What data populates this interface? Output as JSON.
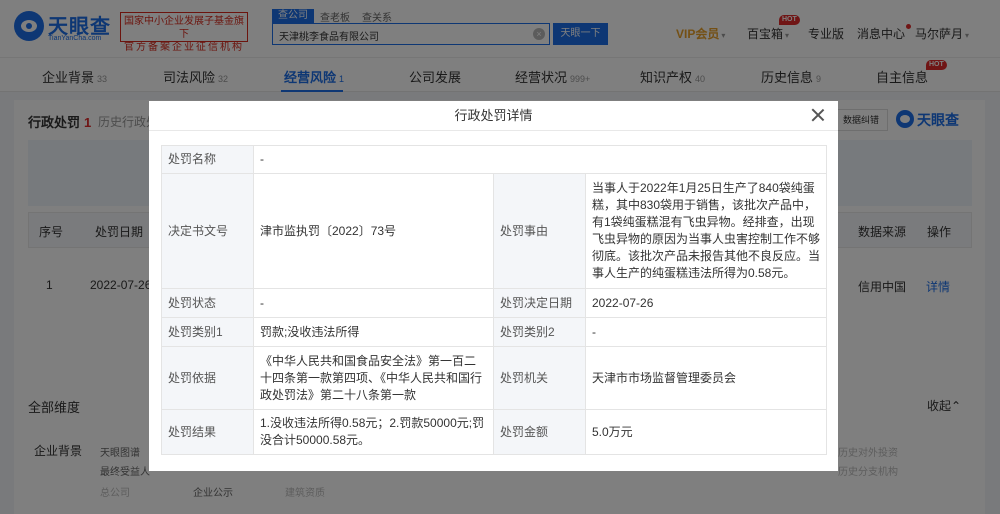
{
  "header": {
    "logo_cn": "天眼查",
    "logo_en": "TianYanCha.com",
    "cert_line1": "国家中小企业发展子基金旗下",
    "cert_line2": "官方备案企业征信机构",
    "search_tabs": [
      "查公司",
      "查老板",
      "查关系"
    ],
    "search_value": "天津桃李食品有限公司",
    "search_clear_glyph": "×",
    "search_button": "天眼一下",
    "vip": "VIP会员",
    "baibaoxiang": "百宝箱",
    "hot_badge": "HOT",
    "professional": "专业版",
    "messages": "消息中心",
    "username": "马尔萨月",
    "caret": "▾",
    "colors": {
      "brand": "#1c6ee8",
      "vip": "#e8a02a",
      "hot": "#e02a2a"
    }
  },
  "category_tabs": [
    {
      "label": "企业背景",
      "count": "33"
    },
    {
      "label": "司法风险",
      "count": "32"
    },
    {
      "label": "经营风险",
      "count": "1",
      "active": true
    },
    {
      "label": "公司发展",
      "count": ""
    },
    {
      "label": "经营状况",
      "count": "999+"
    },
    {
      "label": "知识产权",
      "count": "40"
    },
    {
      "label": "历史信息",
      "count": "9"
    },
    {
      "label": "自主信息",
      "count": ""
    }
  ],
  "section": {
    "title": "行政处罚",
    "count": "1",
    "history": "历史行政处",
    "download_button": "数据纠错",
    "watermark": "天眼查"
  },
  "table": {
    "headers": [
      "序号",
      "处罚日期",
      "数据来源",
      "操作"
    ],
    "row": {
      "index": "1",
      "date": "2022-07-26",
      "source": "信用中国",
      "action": "详情"
    }
  },
  "dimensions": {
    "title": "全部维度",
    "collapse": "收起",
    "collapse_glyph": "⌃",
    "row_label": "企业背景",
    "items": [
      "天眼图谱",
      "最终受益人",
      "总公司",
      "企业公示",
      "建筑资质"
    ],
    "faded_right": [
      "历史对外投资",
      "历史分支机构"
    ]
  },
  "modal": {
    "title": "行政处罚详情",
    "close": "close-icon",
    "rows": [
      {
        "k1": "处罚名称",
        "v1": "-"
      },
      {
        "k1": "决定书文号",
        "v1": "津市监执罚〔2022〕73号",
        "k2": "处罚事由",
        "v2": "当事人于2022年1月25日生产了840袋纯蛋糕，其中830袋用于销售，该批次产品中，有1袋纯蛋糕混有飞虫异物。经排查，出现飞虫异物的原因为当事人虫害控制工作不够彻底。该批次产品未报告其他不良反应。当事人生产的纯蛋糕违法所得为0.58元。"
      },
      {
        "k1": "处罚状态",
        "v1": "-",
        "k2": "处罚决定日期",
        "v2": "2022-07-26"
      },
      {
        "k1": "处罚类别1",
        "v1": "罚款;没收违法所得",
        "k2": "处罚类别2",
        "v2": "-"
      },
      {
        "k1": "处罚依据",
        "v1": "《中华人民共和国食品安全法》第一百二十四条第一款第四项、《中华人民共和国行政处罚法》第二十八条第一款",
        "k2": "处罚机关",
        "v2": "天津市市场监督管理委员会"
      },
      {
        "k1": "处罚结果",
        "v1": "1.没收违法所得0.58元；2.罚款50000元;罚没合计50000.58元。",
        "k2": "处罚金额",
        "v2": "5.0万元"
      }
    ]
  }
}
